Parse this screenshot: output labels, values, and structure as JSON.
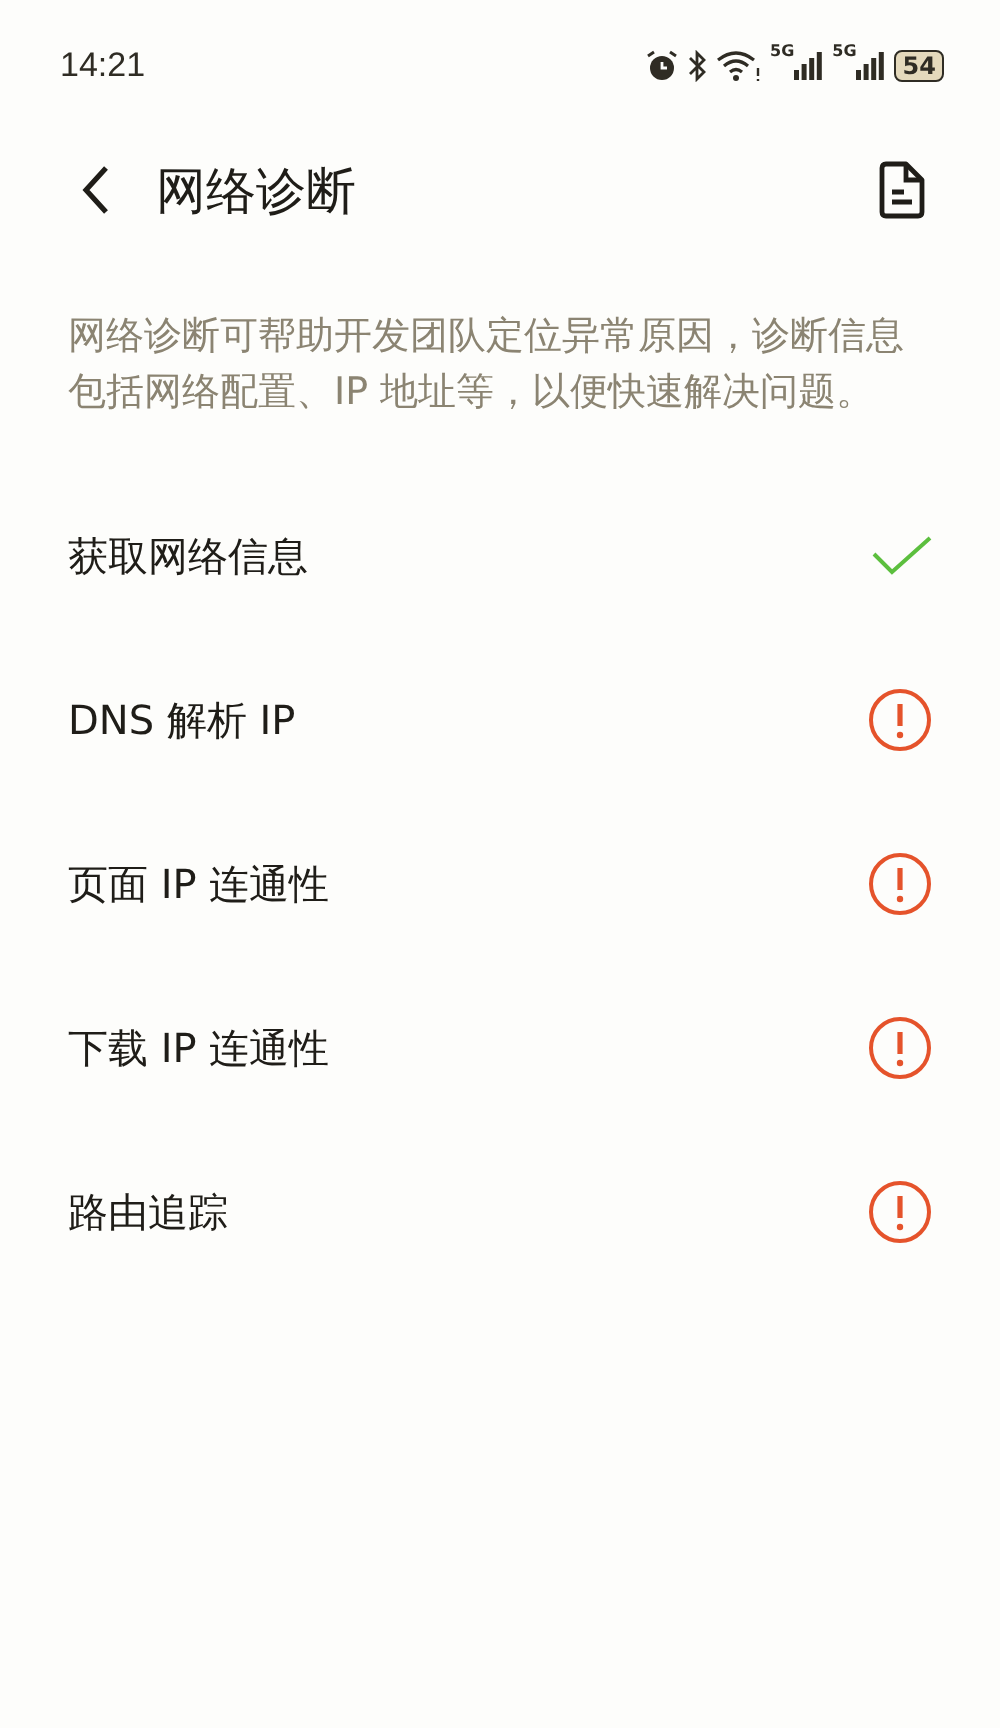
{
  "status_bar": {
    "time": "14:21",
    "networks": [
      "5G",
      "5G"
    ],
    "battery": "54"
  },
  "header": {
    "title": "网络诊断"
  },
  "description": "网络诊断可帮助开发团队定位异常原因，诊断信息包括网络配置、IP 地址等，以便快速解决问题。",
  "steps": [
    {
      "label": "获取网络信息",
      "kind": "ok"
    },
    {
      "label": "DNS 解析 IP",
      "kind": "error"
    },
    {
      "label": "页面 IP 连通性",
      "kind": "error"
    },
    {
      "label": "下载 IP 连通性",
      "kind": "error"
    },
    {
      "label": "路由追踪",
      "kind": "error"
    }
  ]
}
